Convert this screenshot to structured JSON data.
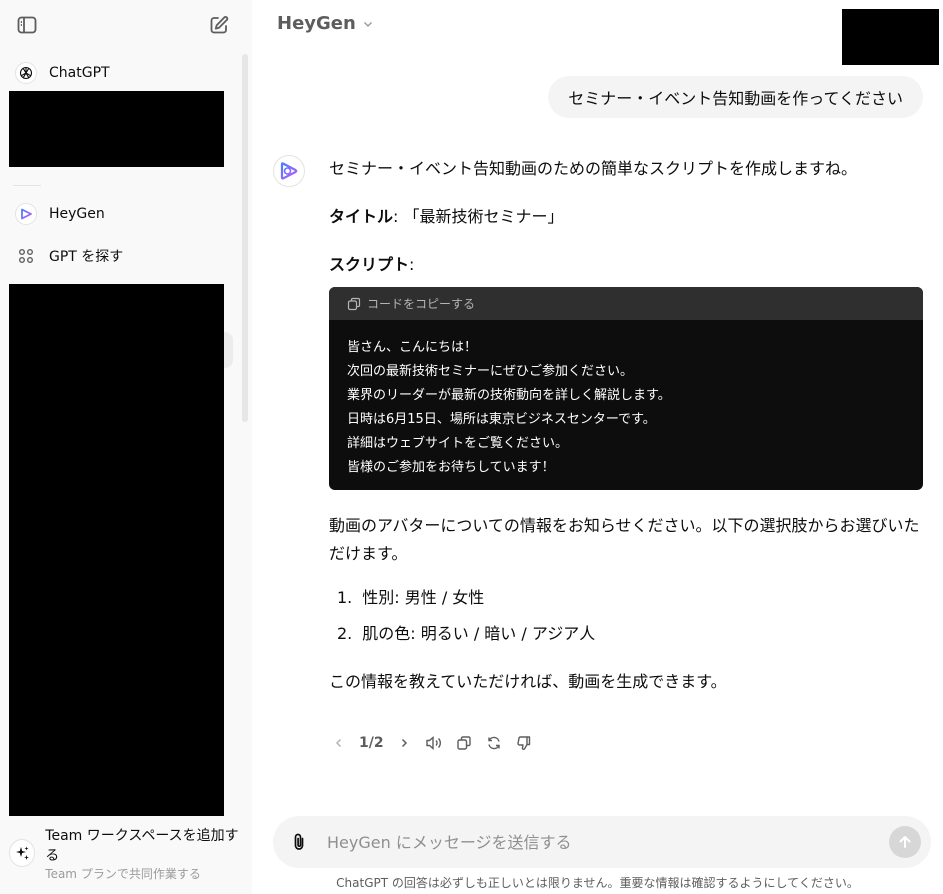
{
  "sidebar": {
    "items": [
      {
        "label": "ChatGPT",
        "icon": "openai-logo-icon"
      },
      {
        "label": "HeyGen",
        "icon": "heygen-logo-icon"
      },
      {
        "label": "GPT を探す",
        "icon": "grid-icon"
      }
    ],
    "team": {
      "title": "Team ワークスペースを追加する",
      "subtitle": "Team プランで共同作業する"
    }
  },
  "header": {
    "model_name": "HeyGen"
  },
  "conversation": {
    "user_message": "セミナー・イベント告知動画を作ってください",
    "assistant": {
      "intro": "セミナー・イベント告知動画のための簡単なスクリプトを作成しますね。",
      "title_label": "タイトル",
      "title_value": ": 「最新技術セミナー」",
      "script_label": "スクリプト",
      "script_colon": ":",
      "copy_code_label": "コードをコピーする",
      "code_lines": [
        "皆さん、こんにちは！",
        "次回の最新技術セミナーにぜひご参加ください。",
        "業界のリーダーが最新の技術動向を詳しく解説します。",
        "日時は6月15日、場所は東京ビジネスセンターです。",
        "詳細はウェブサイトをご覧ください。",
        "皆様のご参加をお待ちしています！"
      ],
      "avatar_prompt": "動画のアバターについての情報をお知らせください。以下の選択肢からお選びいただけます。",
      "options": [
        {
          "num": "1.",
          "text": "性別: 男性 / 女性"
        },
        {
          "num": "2.",
          "text": "肌の色: 明るい / 暗い / アジア人"
        }
      ],
      "closing": "この情報を教えていただければ、動画を生成できます。",
      "pager": "1/2"
    }
  },
  "composer": {
    "placeholder": "HeyGen にメッセージを送信する"
  },
  "disclaimer": "ChatGPT の回答は必ずしも正しいとは限りません。重要な情報は確認するようにしてください。",
  "colors": {
    "heygen_gradient": [
      "#4d7cff",
      "#b25cff"
    ],
    "code_bg": "#0d0d0d",
    "sidebar_bg": "#f9f9f9"
  }
}
